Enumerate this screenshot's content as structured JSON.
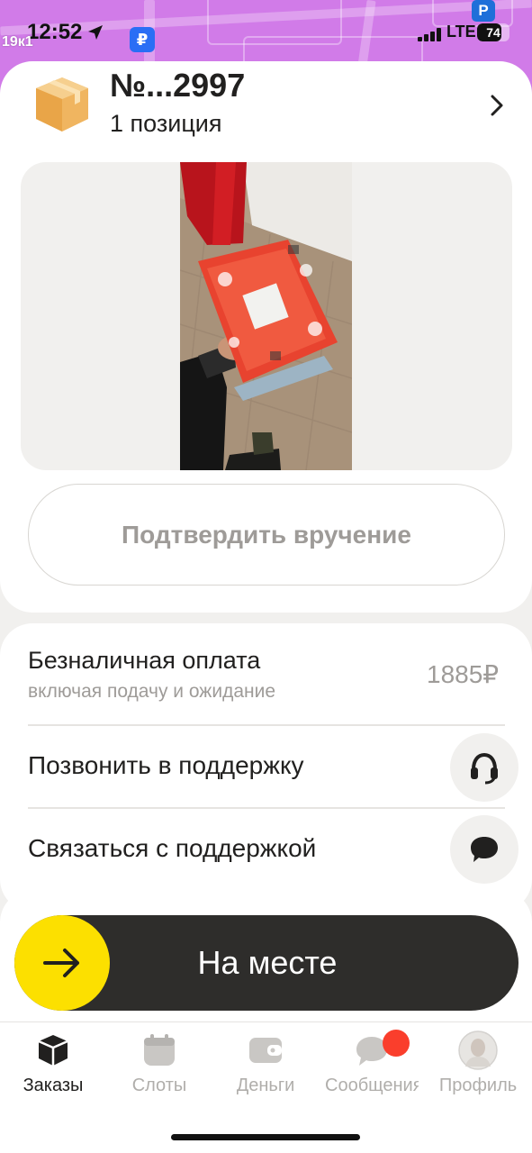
{
  "status_bar": {
    "time": "12:52",
    "carrier": "LTE",
    "battery_level": "74",
    "battery_fraction": 0.74,
    "map_label": "19к1",
    "parking_label": "P",
    "ruble_badge": "₽"
  },
  "order": {
    "number": "№...2997",
    "positions": "1 позиция",
    "box_icon": "package-box-icon",
    "chevron_icon": "chevron-right-icon"
  },
  "actions": {
    "confirm_label": "Подтвердить вручение"
  },
  "payment": {
    "title": "Безналичная оплата",
    "subtitle": "включая подачу и ожидание",
    "amount": "1885₽"
  },
  "support": {
    "call_label": "Позвонить в поддержку",
    "call_icon": "headset-icon",
    "chat_label": "Связаться с поддержкой",
    "chat_icon": "chat-bubble-icon"
  },
  "slider": {
    "label": "На месте",
    "icon": "arrow-right-icon"
  },
  "tabs": [
    {
      "label": "Заказы",
      "icon": "box-icon",
      "active": true
    },
    {
      "label": "Слоты",
      "icon": "calendar-icon",
      "active": false
    },
    {
      "label": "Деньги",
      "icon": "wallet-icon",
      "active": false
    },
    {
      "label": "Сообщения",
      "icon": "message-icon",
      "active": false,
      "has_notification": true
    },
    {
      "label": "Профиль",
      "icon": "avatar-icon",
      "active": false
    }
  ],
  "colors": {
    "accent_yellow": "#fce000",
    "slider_dark": "#2e2d2b",
    "notification_red": "#fa3e2c",
    "map_purple": "#d17be8"
  }
}
